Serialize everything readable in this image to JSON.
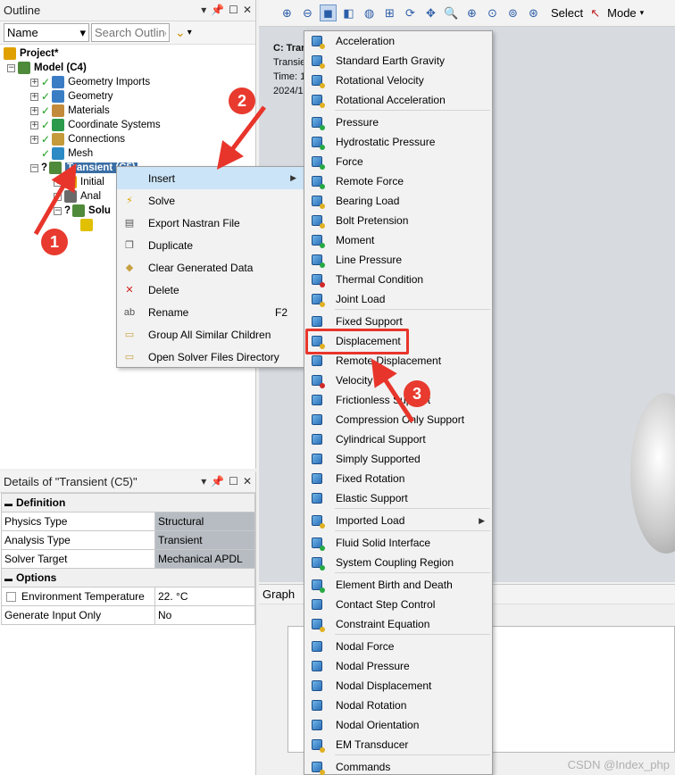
{
  "outline": {
    "title": "Outline",
    "filter_value": "Name",
    "search_placeholder": "Search Outline",
    "tree": [
      {
        "label": "Project*",
        "bold": true,
        "icon_color": "#e0a000"
      },
      {
        "label": "Model (C4)",
        "bold": true,
        "icon_color": "#4f8a3a"
      },
      {
        "label": "Geometry Imports",
        "icon_color": "#3b7dc4"
      },
      {
        "label": "Geometry",
        "icon_color": "#3b7dc4"
      },
      {
        "label": "Materials",
        "icon_color": "#c48a3b"
      },
      {
        "label": "Coordinate Systems",
        "icon_color": "#2c9a4a"
      },
      {
        "label": "Connections",
        "icon_color": "#c49a3b"
      },
      {
        "label": "Mesh",
        "icon_color": "#2c8ac4"
      },
      {
        "label": "Transient (C5)",
        "bold": true,
        "icon_color": "#4f8a3a",
        "prefix": "C"
      },
      {
        "label": "Initial",
        "icon_color": "#e0a000"
      },
      {
        "label": "Anal",
        "icon_color": "#6a6a6a"
      },
      {
        "label": "Solu",
        "bold": true,
        "icon_color": "#4f8a3a"
      },
      {
        "label": "",
        "icon_color": "#e0c000"
      }
    ]
  },
  "details": {
    "title": "Details of \"Transient (C5)\"",
    "sections": [
      {
        "name": "Definition",
        "rows": [
          {
            "key": "Physics Type",
            "value": "Structural",
            "gray": true
          },
          {
            "key": "Analysis Type",
            "value": "Transient",
            "gray": true
          },
          {
            "key": "Solver Target",
            "value": "Mechanical APDL",
            "gray": true
          }
        ]
      },
      {
        "name": "Options",
        "rows": [
          {
            "key": "Environment Temperature",
            "value": "22. °C",
            "gray": false,
            "checkbox": true
          },
          {
            "key": "Generate Input Only",
            "value": "No",
            "gray": false
          }
        ]
      }
    ]
  },
  "toolbar": {
    "select_label": "Select",
    "mode_label": "Mode"
  },
  "viewport": {
    "title": "C: Trar",
    "line1": "Transie",
    "line2": "Time: 1",
    "line3": "2024/1"
  },
  "graph": {
    "title": "Graph"
  },
  "context_menu": [
    {
      "label": "Insert",
      "submenu": true,
      "highlight": true,
      "icon": ""
    },
    {
      "label": "Solve",
      "icon": "⚡",
      "icon_color": "#e0a000"
    },
    {
      "label": "Export Nastran File",
      "icon": "▤",
      "icon_color": "#555555"
    },
    {
      "label": "Duplicate",
      "icon": "❐",
      "icon_color": "#555555"
    },
    {
      "label": "Clear Generated Data",
      "icon": "◆",
      "icon_color": "#c8a040"
    },
    {
      "label": "Delete",
      "icon": "✕",
      "icon_color": "#d02020"
    },
    {
      "label": "Rename",
      "shortcut": "F2",
      "icon": "ab",
      "icon_color": "#555555"
    },
    {
      "label": "Group All Similar Children",
      "icon": "▭",
      "icon_color": "#c8a040"
    },
    {
      "label": "Open Solver Files Directory",
      "icon": "▭",
      "icon_color": "#c8a040"
    }
  ],
  "insert_menu": [
    {
      "label": "Acceleration",
      "v": "yellow"
    },
    {
      "label": "Standard Earth Gravity",
      "v": "yellow"
    },
    {
      "label": "Rotational Velocity",
      "v": "yellow"
    },
    {
      "label": "Rotational Acceleration",
      "v": "yellow",
      "sep_after": true
    },
    {
      "label": "Pressure",
      "v": "green"
    },
    {
      "label": "Hydrostatic Pressure",
      "v": "green"
    },
    {
      "label": "Force",
      "v": "green"
    },
    {
      "label": "Remote Force",
      "v": "green"
    },
    {
      "label": "Bearing Load",
      "v": "yellow"
    },
    {
      "label": "Bolt Pretension",
      "v": "yellow"
    },
    {
      "label": "Moment",
      "v": "green"
    },
    {
      "label": "Line Pressure",
      "v": "green"
    },
    {
      "label": "Thermal Condition",
      "v": "red"
    },
    {
      "label": "Joint Load",
      "v": "yellow",
      "sep_after": true
    },
    {
      "label": "Fixed Support",
      "v": "blue"
    },
    {
      "label": "Displacement",
      "v": "yellow"
    },
    {
      "label": "Remote Displacement",
      "v": "blue"
    },
    {
      "label": "Velocity",
      "v": "red"
    },
    {
      "label": "Frictionless Support",
      "v": "blue"
    },
    {
      "label": "Compression Only Support",
      "v": "blue"
    },
    {
      "label": "Cylindrical Support",
      "v": "blue"
    },
    {
      "label": "Simply Supported",
      "v": "blue"
    },
    {
      "label": "Fixed Rotation",
      "v": "blue"
    },
    {
      "label": "Elastic Support",
      "v": "blue",
      "sep_after": true
    },
    {
      "label": "Imported Load",
      "v": "yellow",
      "submenu": true,
      "sep_after": true
    },
    {
      "label": "Fluid Solid Interface",
      "v": "green"
    },
    {
      "label": "System Coupling Region",
      "v": "green",
      "sep_after": true
    },
    {
      "label": "Element Birth and Death",
      "v": "green"
    },
    {
      "label": "Contact Step Control",
      "v": "blue"
    },
    {
      "label": "Constraint Equation",
      "v": "yellow",
      "sep_after": true
    },
    {
      "label": "Nodal Force",
      "v": "blue"
    },
    {
      "label": "Nodal Pressure",
      "v": "blue"
    },
    {
      "label": "Nodal Displacement",
      "v": "blue"
    },
    {
      "label": "Nodal Rotation",
      "v": "blue"
    },
    {
      "label": "Nodal Orientation",
      "v": "blue"
    },
    {
      "label": "EM Transducer",
      "v": "yellow",
      "sep_after": true
    },
    {
      "label": "Commands",
      "v": "yellow"
    }
  ],
  "annotations": {
    "badge1": "1",
    "badge2": "2",
    "badge3": "3",
    "accent": "#e8352b"
  },
  "watermark": "CSDN @Index_php"
}
